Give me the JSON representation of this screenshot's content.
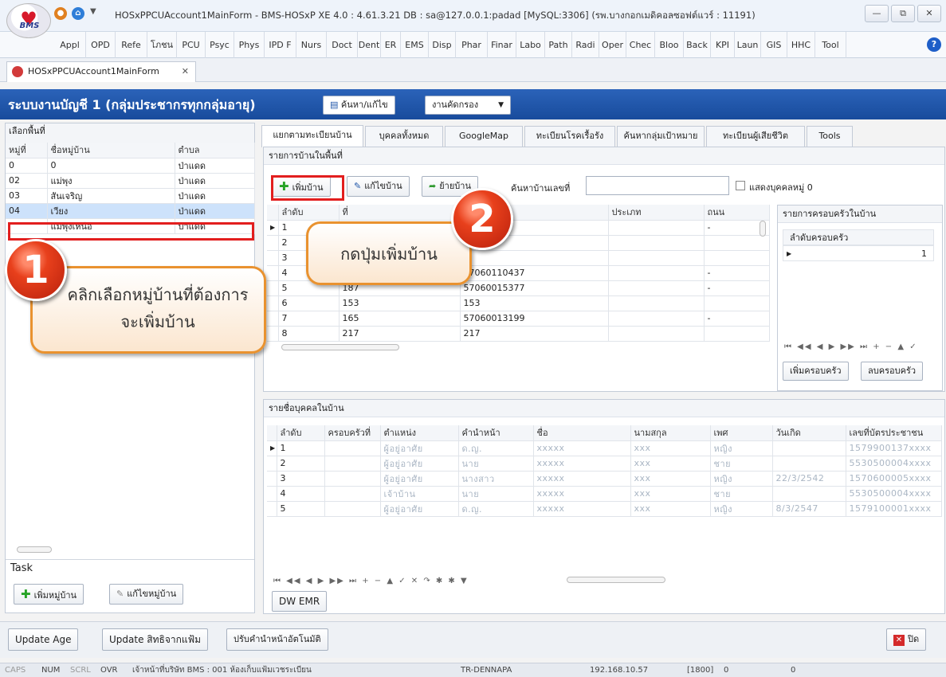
{
  "titlebar": {
    "logo_text": "BMS",
    "title": "HOSxPPCUAccount1MainForm - BMS-HOSxP XE 4.0 : 4.61.3.21 DB : sa@127.0.0.1:padad [MySQL:3306] (รพ.บางกอกเมดิคอลซอฟต์แวร์ : 11191)",
    "min": "—",
    "restore": "⧉",
    "close": "✕"
  },
  "ribbon_tabs": [
    "Appl",
    "OPD",
    "Refe",
    "โภชน",
    "PCU",
    "Psyc",
    "Phys",
    "IPD F",
    "Nurs",
    "Doct",
    "Dent",
    "ER",
    "EMS",
    "Disp",
    "Phar",
    "Finar",
    "Labo",
    "Path",
    "Radi",
    "Oper",
    "Chec",
    "Bloo",
    "Back",
    "KPI",
    "Laun",
    "GIS",
    "HHC",
    "Tool"
  ],
  "doc_tab": {
    "label": "HOSxPPCUAccount1MainForm",
    "close": "✕"
  },
  "header": {
    "title": "ระบบงานบัญชี 1 (กลุ่มประชากรทุกกลุ่มอายุ)",
    "search_btn": "ค้นหา/แก้ไข",
    "screen_btn": "งานคัดกรอง",
    "screen_caret": "▼"
  },
  "left": {
    "title": "เลือกพื้นที่",
    "columns": [
      "หมู่ที่",
      "ชื่อหมู่บ้าน",
      "ตำบล"
    ],
    "rows": [
      {
        "moo": "0",
        "name": "0",
        "tambon": "ป่าแดด"
      },
      {
        "moo": "02",
        "name": "แม่พุง",
        "tambon": "ป่าแดด"
      },
      {
        "moo": "03",
        "name": "สันเจริญ",
        "tambon": "ป่าแดด"
      },
      {
        "moo": "04",
        "name": "เวียง",
        "tambon": "ป่าแดด"
      },
      {
        "moo": "",
        "name": "แม่พุงเหนือ",
        "tambon": "ป่าแดด"
      }
    ],
    "task_label": "Task",
    "add_village": "เพิ่มหมู่บ้าน",
    "edit_village": "แก้ไขหมู่บ้าน"
  },
  "tabs": [
    "แยกตามทะเบียนบ้าน",
    "บุคคลทั้งหมด",
    "GoogleMap",
    "ทะเบียนโรคเรื้อรัง",
    "ค้นหากลุ่มเป้าหมาย",
    "ทะเบียนผู้เสียชีวิต",
    "Tools"
  ],
  "houses": {
    "title": "รายการบ้านในพื้นที่",
    "add_house": "เพิ่มบ้าน",
    "edit_house": "แก้ไขบ้าน",
    "move_house": "ย้ายบ้าน",
    "search_label": "ค้นหาบ้านเลขที่",
    "search_value": "",
    "show_moo0": "แสดงบุคคลหมู่ 0",
    "columns": [
      "ลำดับ",
      "ที่",
      "บ้าน",
      "ประเภท",
      "ถนน"
    ],
    "rows": [
      {
        "no": "1",
        "addr": "",
        "code": "722",
        "type": "",
        "road": "-"
      },
      {
        "no": "2",
        "addr": "",
        "code": "37",
        "type": "",
        "road": ""
      },
      {
        "no": "3",
        "addr": "",
        "code": "1",
        "type": "",
        "road": ""
      },
      {
        "no": "4",
        "addr": "31",
        "code": "57060110437",
        "type": "",
        "road": "-"
      },
      {
        "no": "5",
        "addr": "187",
        "code": "57060015377",
        "type": "",
        "road": "-"
      },
      {
        "no": "6",
        "addr": "153",
        "code": "153",
        "type": "",
        "road": ""
      },
      {
        "no": "7",
        "addr": "165",
        "code": "57060013199",
        "type": "",
        "road": "-"
      },
      {
        "no": "8",
        "addr": "217",
        "code": "217",
        "type": "",
        "road": ""
      }
    ]
  },
  "families": {
    "title": "รายการครอบครัวในบ้าน",
    "column": "ลำดับครอบครัว",
    "rows": [
      "1"
    ],
    "nav": "⏮ ◀◀ ◀ ▶ ▶▶ ⏭ + − ▲ ✓",
    "add_family": "เพิ่มครอบครัว",
    "del_family": "ลบครอบครัว"
  },
  "persons": {
    "title": "รายชื่อบุคคลในบ้าน",
    "columns": [
      "ลำดับ",
      "ครอบครัวที่",
      "ตำแหน่ง",
      "คำนำหน้า",
      "ชื่อ",
      "นามสกุล",
      "เพศ",
      "วันเกิด",
      "เลขที่บัตรประชาชน"
    ],
    "rows": [
      {
        "no": "1",
        "fam": "",
        "pos": "ผู้อยู่อาศัย",
        "prefix": "ด.ญ.",
        "fname": "xxxxx",
        "lname": "xxx",
        "sex": "หญิง",
        "dob": "",
        "cid": "1579900137xxxx"
      },
      {
        "no": "2",
        "fam": "",
        "pos": "ผู้อยู่อาศัย",
        "prefix": "นาย",
        "fname": "xxxxx",
        "lname": "xxx",
        "sex": "ชาย",
        "dob": "",
        "cid": "5530500004xxxx"
      },
      {
        "no": "3",
        "fam": "",
        "pos": "ผู้อยู่อาศัย",
        "prefix": "นางสาว",
        "fname": "xxxxx",
        "lname": "xxx",
        "sex": "หญิง",
        "dob": "22/3/2542",
        "cid": "1570600005xxxx"
      },
      {
        "no": "4",
        "fam": "",
        "pos": "เจ้าบ้าน",
        "prefix": "นาย",
        "fname": "xxxxx",
        "lname": "xxx",
        "sex": "ชาย",
        "dob": "",
        "cid": "5530500004xxxx"
      },
      {
        "no": "5",
        "fam": "",
        "pos": "ผู้อยู่อาศัย",
        "prefix": "ด.ญ.",
        "fname": "xxxxx",
        "lname": "xxx",
        "sex": "หญิง",
        "dob": "8/3/2547",
        "cid": "1579100001xxxx"
      }
    ],
    "nav": "⏮ ◀◀ ◀ ▶ ▶▶ ⏭ + − ▲ ✓ ✕ ↷ ✱ ✱ ▼",
    "dw_emr": "DW EMR"
  },
  "bottom": {
    "update_age": "Update Age",
    "update_right": "Update สิทธิจากแฟ้ม",
    "adjust_prefix": "ปรับคำนำหน้าอัตโนมัติ",
    "close": "ปิด"
  },
  "status": {
    "caps": "CAPS",
    "num": "NUM",
    "scrl": "SCRL",
    "ovr": "OVR",
    "user": "เจ้าหน้าที่บริษัท BMS : 001 ห้องเก็บแฟ้มเวชระเบียน",
    "computer": "TR-DENNAPA",
    "ip": "192.168.10.57",
    "code": "[1800]",
    "v1": "0",
    "v2": "0"
  },
  "callouts": {
    "step1_number": "1",
    "step1_text": "คลิกเลือกหมู่บ้านที่ต้องการจะเพิ่มบ้าน",
    "step2_number": "2",
    "step2_text": "กดปุ่มเพิ่มบ้าน"
  },
  "colors": {
    "header_blue": "#1f56a8",
    "callout_border": "#e9922f",
    "step_red": "#e8401c",
    "highlight_red": "#e21e1e"
  }
}
